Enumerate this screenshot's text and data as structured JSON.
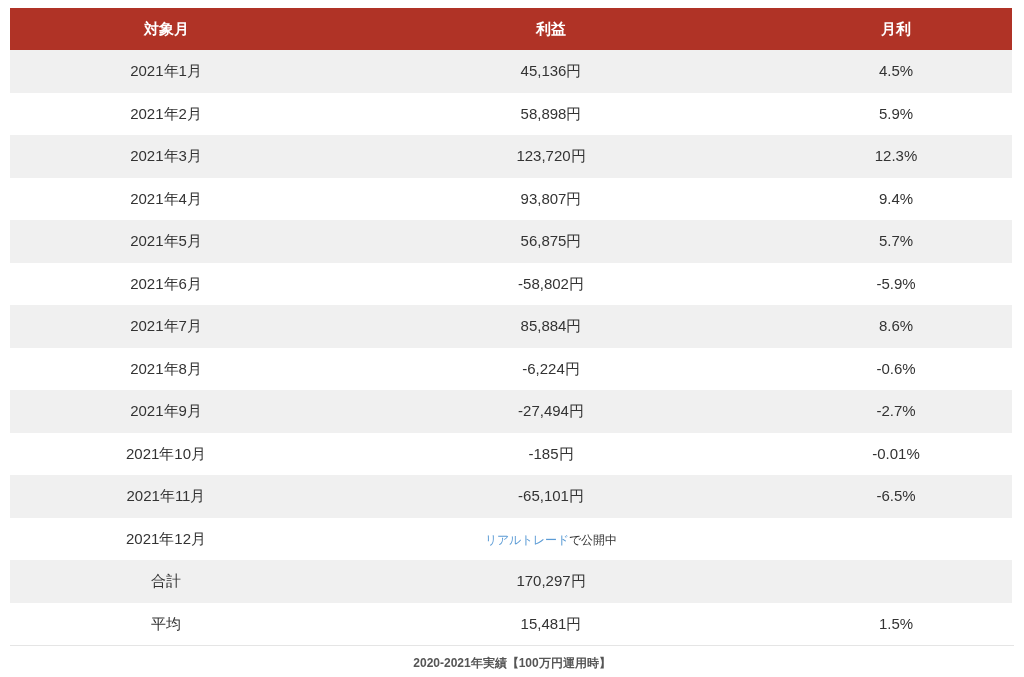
{
  "table": {
    "columns": [
      "対象月",
      "利益",
      "月利"
    ],
    "rows": [
      {
        "kind": "value",
        "month": "2021年1月",
        "profit": "45,136円",
        "rate": "4.5%"
      },
      {
        "kind": "value",
        "month": "2021年2月",
        "profit": "58,898円",
        "rate": "5.9%"
      },
      {
        "kind": "value",
        "month": "2021年3月",
        "profit": "123,720円",
        "rate": "12.3%"
      },
      {
        "kind": "value",
        "month": "2021年4月",
        "profit": "93,807円",
        "rate": "9.4%"
      },
      {
        "kind": "value",
        "month": "2021年5月",
        "profit": "56,875円",
        "rate": "5.7%"
      },
      {
        "kind": "value",
        "month": "2021年6月",
        "profit": "-58,802円",
        "rate": "-5.9%"
      },
      {
        "kind": "value",
        "month": "2021年7月",
        "profit": "85,884円",
        "rate": "8.6%"
      },
      {
        "kind": "value",
        "month": "2021年8月",
        "profit": "-6,224円",
        "rate": "-0.6%"
      },
      {
        "kind": "value",
        "month": "2021年9月",
        "profit": "-27,494円",
        "rate": "-2.7%"
      },
      {
        "kind": "value",
        "month": "2021年10月",
        "profit": "-185円",
        "rate": "-0.01%"
      },
      {
        "kind": "value",
        "month": "2021年11月",
        "profit": "-65,101円",
        "rate": "-6.5%"
      },
      {
        "kind": "note",
        "month": "2021年12月",
        "link": "リアルトレード",
        "text": "で公開中"
      },
      {
        "kind": "value",
        "month": "合計",
        "profit": "170,297円"
      },
      {
        "kind": "value",
        "month": "平均",
        "profit": "15,481円",
        "rate": "1.5%"
      }
    ]
  },
  "caption": "2020-2021年実績【100万円運用時】"
}
